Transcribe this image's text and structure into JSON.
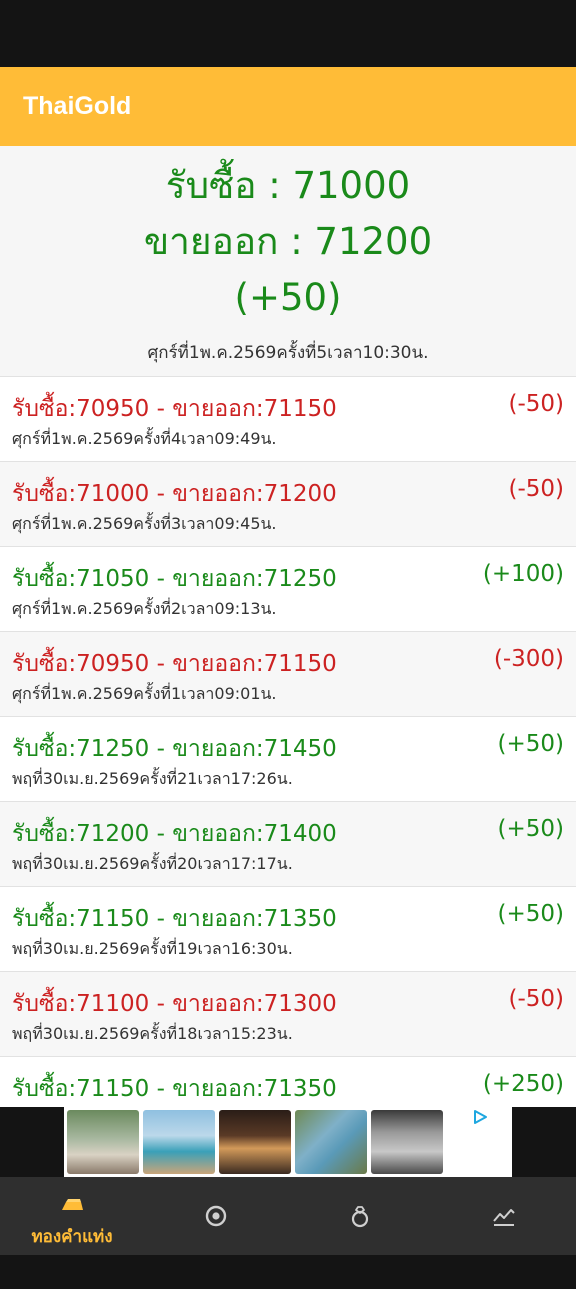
{
  "app": {
    "title": "ThaiGold"
  },
  "summary": {
    "buy": "รับซื้อ : 71000",
    "sell": "ขายออก : 71200",
    "change": "(+50)",
    "time": "ศุกร์ที่1พ.ค.2569ครั้งที่5เวลา10:30น."
  },
  "history": [
    {
      "text": "รับซื้อ:70950 - ขายออก:71150",
      "change": "(-50)",
      "time": "ศุกร์ที่1พ.ค.2569ครั้งที่4เวลา09:49น.",
      "trend": "down"
    },
    {
      "text": "รับซื้อ:71000 - ขายออก:71200",
      "change": "(-50)",
      "time": "ศุกร์ที่1พ.ค.2569ครั้งที่3เวลา09:45น.",
      "trend": "down"
    },
    {
      "text": "รับซื้อ:71050 - ขายออก:71250",
      "change": "(+100)",
      "time": "ศุกร์ที่1พ.ค.2569ครั้งที่2เวลา09:13น.",
      "trend": "up"
    },
    {
      "text": "รับซื้อ:70950 - ขายออก:71150",
      "change": "(-300)",
      "time": "ศุกร์ที่1พ.ค.2569ครั้งที่1เวลา09:01น.",
      "trend": "down"
    },
    {
      "text": "รับซื้อ:71250 - ขายออก:71450",
      "change": "(+50)",
      "time": "พฤที่30เม.ย.2569ครั้งที่21เวลา17:26น.",
      "trend": "up"
    },
    {
      "text": "รับซื้อ:71200 - ขายออก:71400",
      "change": "(+50)",
      "time": "พฤที่30เม.ย.2569ครั้งที่20เวลา17:17น.",
      "trend": "up"
    },
    {
      "text": "รับซื้อ:71150 - ขายออก:71350",
      "change": "(+50)",
      "time": "พฤที่30เม.ย.2569ครั้งที่19เวลา16:30น.",
      "trend": "up"
    },
    {
      "text": "รับซื้อ:71100 - ขายออก:71300",
      "change": "(-50)",
      "time": "พฤที่30เม.ย.2569ครั้งที่18เวลา15:23น.",
      "trend": "down"
    },
    {
      "text": "รับซื้อ:71150 - ขายออก:71350",
      "change": "(+250)",
      "time": "",
      "trend": "up"
    }
  ],
  "nav": {
    "items": [
      {
        "label": "ทองคำแท่ง",
        "icon": "gold-bar-icon",
        "active": true
      },
      {
        "label": "",
        "icon": "coin-icon",
        "active": false
      },
      {
        "label": "",
        "icon": "ring-icon",
        "active": false
      },
      {
        "label": "",
        "icon": "chart-icon",
        "active": false
      }
    ]
  },
  "colors": {
    "accent": "#ffbc37",
    "up": "#1a8a1a",
    "down": "#cc2222",
    "nav_bg": "#2f2f2f"
  }
}
